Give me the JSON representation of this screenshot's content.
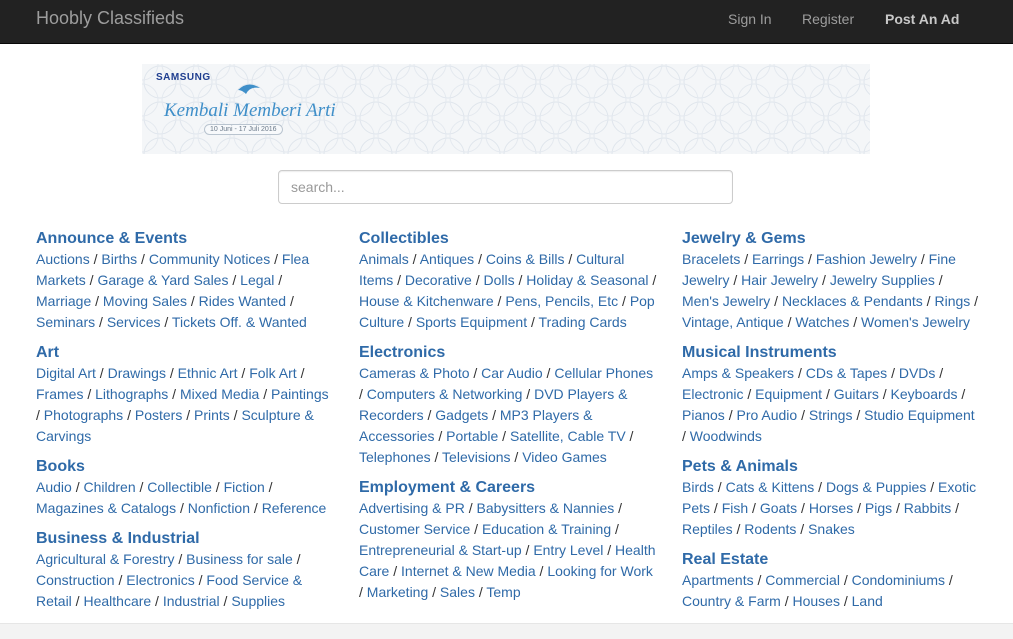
{
  "app": {
    "brand": "Hoobly Classifieds"
  },
  "nav": {
    "sign_in": "Sign In",
    "register": "Register",
    "post_ad": "Post An Ad"
  },
  "banner": {
    "brand": "SAMSUNG",
    "title": "Kembali Memberi Arti",
    "dates": "10 Juni - 17 Juli 2016"
  },
  "search": {
    "placeholder": "search..."
  },
  "columns": [
    [
      {
        "title": "Announce & Events",
        "items": [
          "Auctions",
          "Births",
          "Community Notices",
          "Flea Markets",
          "Garage & Yard Sales",
          "Legal",
          "Marriage",
          "Moving Sales",
          "Rides Wanted",
          "Seminars",
          "Services",
          "Tickets Off. & Wanted"
        ]
      },
      {
        "title": "Art",
        "items": [
          "Digital Art",
          "Drawings",
          "Ethnic Art",
          "Folk Art",
          "Frames",
          "Lithographs",
          "Mixed Media",
          "Paintings",
          "Photographs",
          "Posters",
          "Prints",
          "Sculpture & Carvings"
        ]
      },
      {
        "title": "Books",
        "items": [
          "Audio",
          "Children",
          "Collectible",
          "Fiction",
          "Magazines & Catalogs",
          "Nonfiction",
          "Reference"
        ]
      },
      {
        "title": "Business & Industrial",
        "items": [
          "Agricultural & Forestry",
          "Business for sale",
          "Construction",
          "Electronics",
          "Food Service & Retail",
          "Healthcare",
          "Industrial",
          "Supplies"
        ]
      }
    ],
    [
      {
        "title": "Collectibles",
        "items": [
          "Animals",
          "Antiques",
          "Coins & Bills",
          "Cultural Items",
          "Decorative",
          "Dolls",
          "Holiday & Seasonal",
          "House & Kitchenware",
          "Pens, Pencils, Etc",
          "Pop Culture",
          "Sports Equipment",
          "Trading Cards"
        ]
      },
      {
        "title": "Electronics",
        "items": [
          "Cameras & Photo",
          "Car Audio",
          "Cellular Phones",
          "Computers & Networking",
          "DVD Players & Recorders",
          "Gadgets",
          "MP3 Players & Accessories",
          "Portable",
          "Satellite, Cable TV",
          "Telephones",
          "Televisions",
          "Video Games"
        ]
      },
      {
        "title": "Employment & Careers",
        "items": [
          "Advertising & PR",
          "Babysitters & Nannies",
          "Customer Service",
          "Education & Training",
          "Entrepreneurial & Start-up",
          "Entry Level",
          "Health Care",
          "Internet & New Media",
          "Looking for Work",
          "Marketing",
          "Sales",
          "Temp"
        ]
      }
    ],
    [
      {
        "title": "Jewelry & Gems",
        "items": [
          "Bracelets",
          "Earrings",
          "Fashion Jewelry",
          "Fine Jewelry",
          "Hair Jewelry",
          "Jewelry Supplies",
          "Men's Jewelry",
          "Necklaces & Pendants",
          "Rings",
          "Vintage, Antique",
          "Watches",
          "Women's Jewelry"
        ]
      },
      {
        "title": "Musical Instruments",
        "items": [
          "Amps & Speakers",
          "CDs & Tapes",
          "DVDs",
          "Electronic",
          "Equipment",
          "Guitars",
          "Keyboards",
          "Pianos",
          "Pro Audio",
          "Strings",
          "Studio Equipment",
          "Woodwinds"
        ]
      },
      {
        "title": "Pets & Animals",
        "items": [
          "Birds",
          "Cats & Kittens",
          "Dogs & Puppies",
          "Exotic Pets",
          "Fish",
          "Goats",
          "Horses",
          "Pigs",
          "Rabbits",
          "Reptiles",
          "Rodents",
          "Snakes"
        ]
      },
      {
        "title": "Real Estate",
        "items": [
          "Apartments",
          "Commercial",
          "Condominiums",
          "Country & Farm",
          "Houses",
          "Land"
        ]
      }
    ]
  ],
  "colors": {
    "navbar": "#222222",
    "link": "#2f6aa8",
    "muted_nav": "#9d9d9d"
  }
}
